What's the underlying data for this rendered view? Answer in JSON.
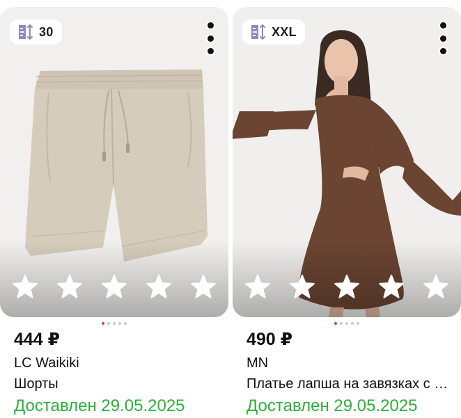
{
  "products": [
    {
      "size": "30",
      "price": "444 ₽",
      "brand": "LC Waikiki",
      "title": "Шорты",
      "status": "Доставлен 29.05.2025",
      "rating_stars": 5,
      "image_pages": 5,
      "image_active": 1
    },
    {
      "size": "XXL",
      "price": "490 ₽",
      "brand": "MN",
      "title": "Платье лапша на завязках с длинным рукавом",
      "status": "Доставлен 29.05.2025",
      "rating_stars": 5,
      "image_pages": 5,
      "image_active": 1
    }
  ],
  "colors": {
    "delivered": "#2eae3b",
    "pager_active": "#b23dd6",
    "pager_inactive": "#c9c9d1",
    "size_icon": "#8f87c6"
  },
  "icons": {
    "size": "size-icon",
    "more": "more-vertical-icon",
    "star": "star-icon"
  }
}
